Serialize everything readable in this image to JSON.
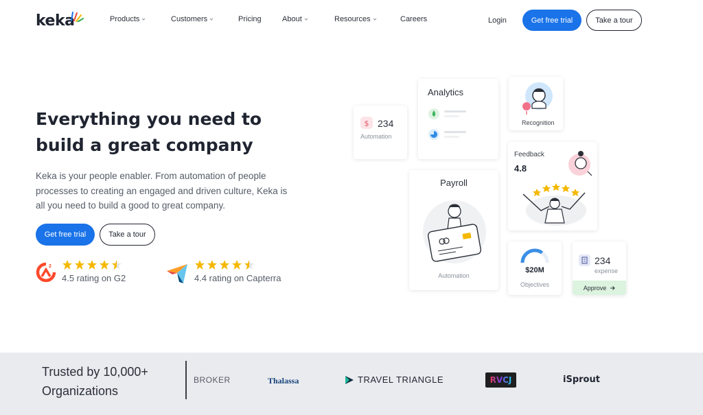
{
  "nav": {
    "logo": "keka",
    "items": [
      {
        "label": "Products",
        "dropdown": true
      },
      {
        "label": "Customers",
        "dropdown": true
      },
      {
        "label": "Pricing",
        "dropdown": false
      },
      {
        "label": "About",
        "dropdown": true
      },
      {
        "label": "Resources",
        "dropdown": true
      },
      {
        "label": "Careers",
        "dropdown": false
      }
    ],
    "login": "Login",
    "cta_trial": "Get free trial",
    "cta_tour": "Take a tour"
  },
  "hero": {
    "title_line1": "Everything you need to",
    "title_line2": "build a great company",
    "description": "Keka is your people enabler. From automation of people processes to creating an engaged and driven culture, Keka is all you need to build a good to great company.",
    "cta_trial": "Get free trial",
    "cta_tour": "Take a tour",
    "ratings": [
      {
        "source": "G2",
        "text": "4.5 rating on G2",
        "value": 4.5
      },
      {
        "source": "Capterra",
        "text": "4.4 rating on Capterra",
        "value": 4.4
      }
    ]
  },
  "cards": {
    "automation_small": {
      "value": "234",
      "label": "Automation"
    },
    "analytics": {
      "title": "Analytics"
    },
    "recognition": {
      "label": "Recognition"
    },
    "feedback": {
      "title": "Feedback",
      "value": "4.8"
    },
    "payroll": {
      "title": "Payroll",
      "label": "Automation"
    },
    "objectives": {
      "value": "$20M",
      "label": "Objectives",
      "progress": 0.7
    },
    "expense": {
      "value": "234",
      "label": "expense",
      "action": "Approve"
    }
  },
  "trusted": {
    "line1": "Trusted by 10,000+",
    "line2": "Organizations",
    "clients": [
      "BROKER",
      "Thalassa",
      "TRAVEL TRIANGLE",
      "RVCJ",
      "iSprout"
    ]
  },
  "colors": {
    "primary": "#1a73e8",
    "text": "#1f2430",
    "star": "#f5b800",
    "band": "#e9ebef"
  }
}
